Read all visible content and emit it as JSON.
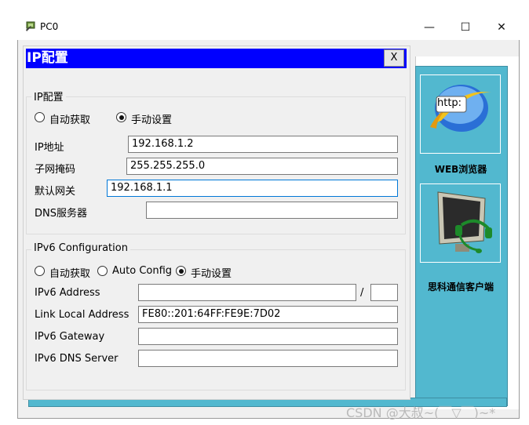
{
  "window": {
    "title": "PC0",
    "minimize_glyph": "—",
    "maximize_glyph": "☐",
    "close_glyph": "✕"
  },
  "dialog": {
    "title": "IP配置",
    "close_label": "X"
  },
  "ipv4": {
    "legend": "IP配置",
    "mode_auto": "自动获取",
    "mode_manual": "手动设置",
    "selected_mode": "manual",
    "ip_label": "IP地址",
    "ip_value": "192.168.1.2",
    "mask_label": "子网掩码",
    "mask_value": "255.255.255.0",
    "gateway_label": "默认网关",
    "gateway_value": "192.168.1.1",
    "dns_label": "DNS服务器",
    "dns_value": ""
  },
  "ipv6": {
    "legend": "IPv6 Configuration",
    "mode_auto": "自动获取",
    "mode_autoconfig": "Auto Config",
    "mode_manual": "手动设置",
    "selected_mode": "manual",
    "address_label": "IPv6 Address",
    "address_value": "",
    "prefix_separator": "/",
    "prefix_value": "",
    "link_local_label": "Link Local Address",
    "link_local_value": "FE80::201:64FF:FE9E:7D02",
    "gateway_label": "IPv6 Gateway",
    "gateway_value": "",
    "dns_label": "IPv6 DNS Server",
    "dns_value": ""
  },
  "desktop": {
    "apps": [
      {
        "label": "WEB浏览器",
        "icon": "web-browser-icon",
        "icon_text": "http:"
      },
      {
        "label": "思科通信客户端",
        "icon": "communicator-icon"
      }
    ]
  },
  "watermark": "CSDN @大叔~(￣▽￣)~*",
  "colors": {
    "dialog_title_bg": "#0000ff",
    "desktop_bg": "#52b8cf",
    "focus_border": "#0078d7"
  }
}
